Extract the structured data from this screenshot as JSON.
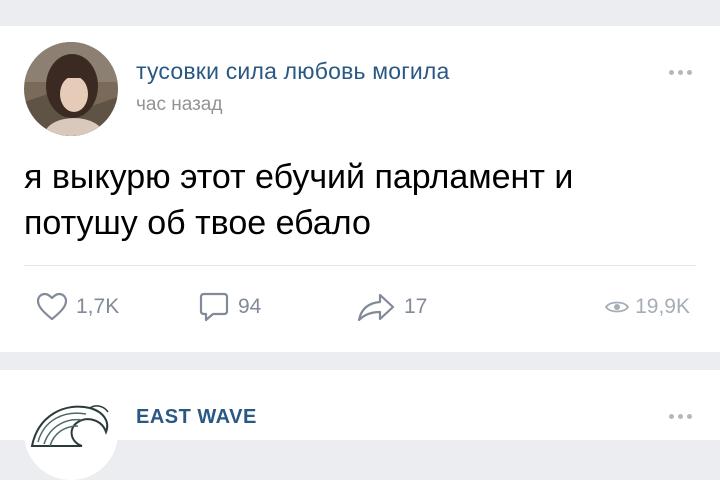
{
  "colors": {
    "page_bg": "#ebedf0",
    "card_bg": "#ffffff",
    "author_link": "#2a5885",
    "meta_text": "#939393",
    "action_icon": "#828a99",
    "views_text": "#a6adb6"
  },
  "feed": {
    "posts": [
      {
        "author": "тусовки сила любовь могила",
        "time": "час назад",
        "text": "я выкурю этот ебучий парламент и потушу об твое ебало",
        "more_icon": "ellipsis-icon",
        "actions": {
          "likes": {
            "icon": "heart-icon",
            "count": "1,7K"
          },
          "comments": {
            "icon": "comment-bubble-icon",
            "count": "94"
          },
          "shares": {
            "icon": "share-arrow-icon",
            "count": "17"
          },
          "views": {
            "icon": "eye-icon",
            "count": "19,9K"
          }
        }
      },
      {
        "author": "EAST WAVE",
        "more_icon": "ellipsis-icon"
      }
    ]
  }
}
